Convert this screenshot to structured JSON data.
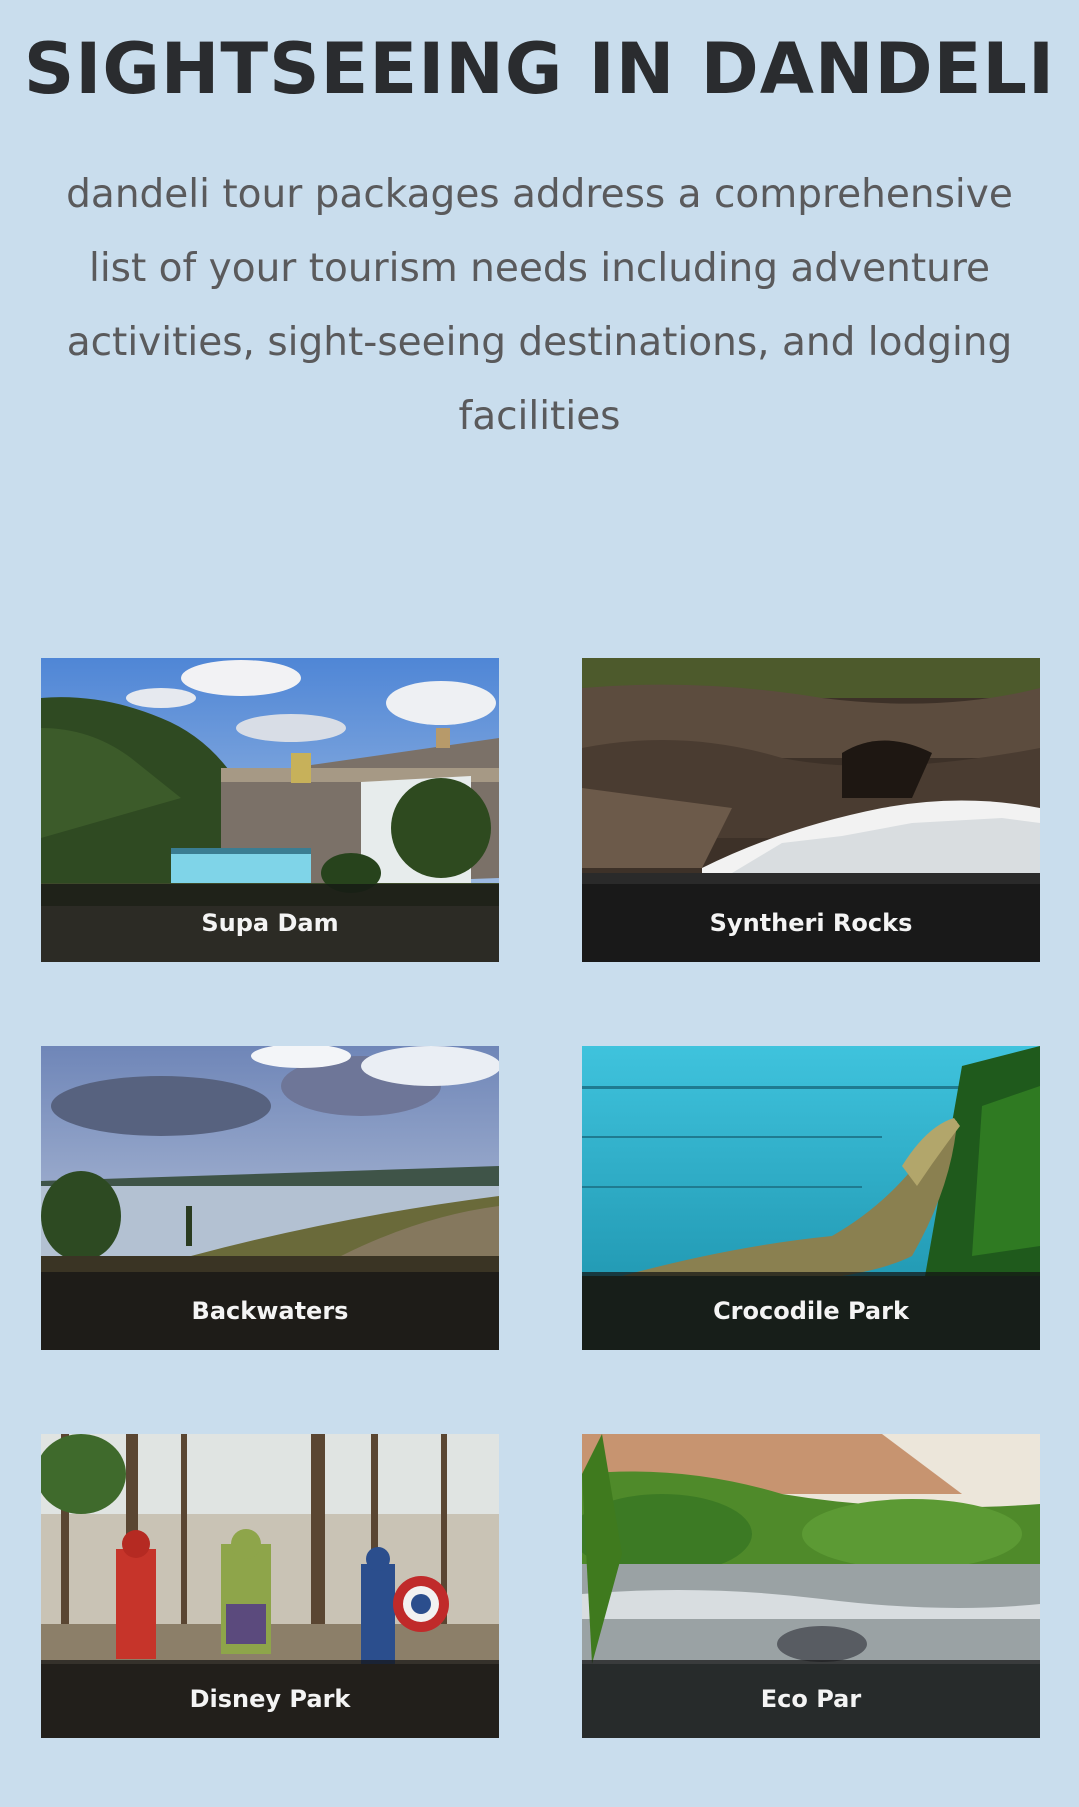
{
  "header": {
    "title": "SIGHTSEEING IN DANDELI",
    "description": "dandeli tour packages address a comprehensive list of your tourism needs including adventure activities, sight-seeing destinations, and lodging facilities"
  },
  "places": [
    {
      "label": "Supa Dam",
      "image": "dam-photo"
    },
    {
      "label": "Syntheri Rocks",
      "image": "waterfall-rocks-photo"
    },
    {
      "label": "Backwaters",
      "image": "lake-road-photo"
    },
    {
      "label": "Crocodile Park",
      "image": "crocodile-photo"
    },
    {
      "label": "Disney Park",
      "image": "superhero-statues-photo"
    },
    {
      "label": "Eco Par",
      "image": "river-rapids-photo"
    }
  ]
}
